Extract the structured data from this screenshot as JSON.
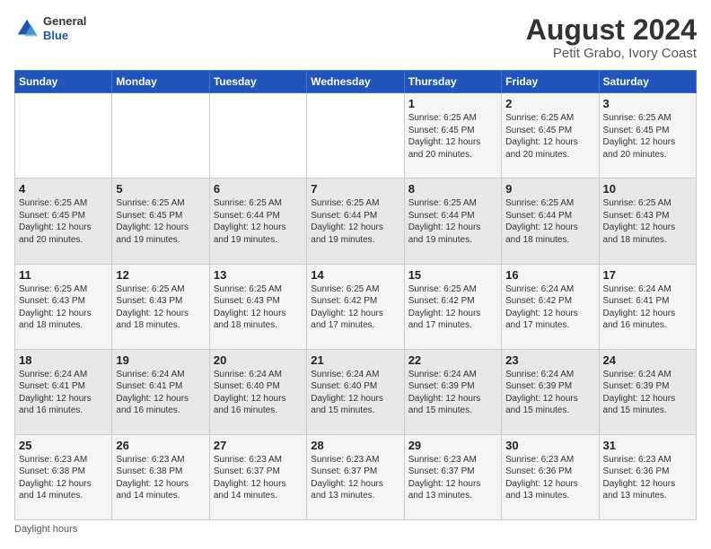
{
  "header": {
    "logo_line1": "General",
    "logo_line2": "Blue",
    "title": "August 2024",
    "subtitle": "Petit Grabo, Ivory Coast"
  },
  "footer": {
    "note": "Daylight hours"
  },
  "days_of_week": [
    "Sunday",
    "Monday",
    "Tuesday",
    "Wednesday",
    "Thursday",
    "Friday",
    "Saturday"
  ],
  "weeks": [
    [
      {
        "num": "",
        "info": ""
      },
      {
        "num": "",
        "info": ""
      },
      {
        "num": "",
        "info": ""
      },
      {
        "num": "",
        "info": ""
      },
      {
        "num": "1",
        "info": "Sunrise: 6:25 AM\nSunset: 6:45 PM\nDaylight: 12 hours\nand 20 minutes."
      },
      {
        "num": "2",
        "info": "Sunrise: 6:25 AM\nSunset: 6:45 PM\nDaylight: 12 hours\nand 20 minutes."
      },
      {
        "num": "3",
        "info": "Sunrise: 6:25 AM\nSunset: 6:45 PM\nDaylight: 12 hours\nand 20 minutes."
      }
    ],
    [
      {
        "num": "4",
        "info": "Sunrise: 6:25 AM\nSunset: 6:45 PM\nDaylight: 12 hours\nand 20 minutes."
      },
      {
        "num": "5",
        "info": "Sunrise: 6:25 AM\nSunset: 6:45 PM\nDaylight: 12 hours\nand 19 minutes."
      },
      {
        "num": "6",
        "info": "Sunrise: 6:25 AM\nSunset: 6:44 PM\nDaylight: 12 hours\nand 19 minutes."
      },
      {
        "num": "7",
        "info": "Sunrise: 6:25 AM\nSunset: 6:44 PM\nDaylight: 12 hours\nand 19 minutes."
      },
      {
        "num": "8",
        "info": "Sunrise: 6:25 AM\nSunset: 6:44 PM\nDaylight: 12 hours\nand 19 minutes."
      },
      {
        "num": "9",
        "info": "Sunrise: 6:25 AM\nSunset: 6:44 PM\nDaylight: 12 hours\nand 18 minutes."
      },
      {
        "num": "10",
        "info": "Sunrise: 6:25 AM\nSunset: 6:43 PM\nDaylight: 12 hours\nand 18 minutes."
      }
    ],
    [
      {
        "num": "11",
        "info": "Sunrise: 6:25 AM\nSunset: 6:43 PM\nDaylight: 12 hours\nand 18 minutes."
      },
      {
        "num": "12",
        "info": "Sunrise: 6:25 AM\nSunset: 6:43 PM\nDaylight: 12 hours\nand 18 minutes."
      },
      {
        "num": "13",
        "info": "Sunrise: 6:25 AM\nSunset: 6:43 PM\nDaylight: 12 hours\nand 18 minutes."
      },
      {
        "num": "14",
        "info": "Sunrise: 6:25 AM\nSunset: 6:42 PM\nDaylight: 12 hours\nand 17 minutes."
      },
      {
        "num": "15",
        "info": "Sunrise: 6:25 AM\nSunset: 6:42 PM\nDaylight: 12 hours\nand 17 minutes."
      },
      {
        "num": "16",
        "info": "Sunrise: 6:24 AM\nSunset: 6:42 PM\nDaylight: 12 hours\nand 17 minutes."
      },
      {
        "num": "17",
        "info": "Sunrise: 6:24 AM\nSunset: 6:41 PM\nDaylight: 12 hours\nand 16 minutes."
      }
    ],
    [
      {
        "num": "18",
        "info": "Sunrise: 6:24 AM\nSunset: 6:41 PM\nDaylight: 12 hours\nand 16 minutes."
      },
      {
        "num": "19",
        "info": "Sunrise: 6:24 AM\nSunset: 6:41 PM\nDaylight: 12 hours\nand 16 minutes."
      },
      {
        "num": "20",
        "info": "Sunrise: 6:24 AM\nSunset: 6:40 PM\nDaylight: 12 hours\nand 16 minutes."
      },
      {
        "num": "21",
        "info": "Sunrise: 6:24 AM\nSunset: 6:40 PM\nDaylight: 12 hours\nand 15 minutes."
      },
      {
        "num": "22",
        "info": "Sunrise: 6:24 AM\nSunset: 6:39 PM\nDaylight: 12 hours\nand 15 minutes."
      },
      {
        "num": "23",
        "info": "Sunrise: 6:24 AM\nSunset: 6:39 PM\nDaylight: 12 hours\nand 15 minutes."
      },
      {
        "num": "24",
        "info": "Sunrise: 6:24 AM\nSunset: 6:39 PM\nDaylight: 12 hours\nand 15 minutes."
      }
    ],
    [
      {
        "num": "25",
        "info": "Sunrise: 6:23 AM\nSunset: 6:38 PM\nDaylight: 12 hours\nand 14 minutes."
      },
      {
        "num": "26",
        "info": "Sunrise: 6:23 AM\nSunset: 6:38 PM\nDaylight: 12 hours\nand 14 minutes."
      },
      {
        "num": "27",
        "info": "Sunrise: 6:23 AM\nSunset: 6:37 PM\nDaylight: 12 hours\nand 14 minutes."
      },
      {
        "num": "28",
        "info": "Sunrise: 6:23 AM\nSunset: 6:37 PM\nDaylight: 12 hours\nand 13 minutes."
      },
      {
        "num": "29",
        "info": "Sunrise: 6:23 AM\nSunset: 6:37 PM\nDaylight: 12 hours\nand 13 minutes."
      },
      {
        "num": "30",
        "info": "Sunrise: 6:23 AM\nSunset: 6:36 PM\nDaylight: 12 hours\nand 13 minutes."
      },
      {
        "num": "31",
        "info": "Sunrise: 6:23 AM\nSunset: 6:36 PM\nDaylight: 12 hours\nand 13 minutes."
      }
    ]
  ]
}
